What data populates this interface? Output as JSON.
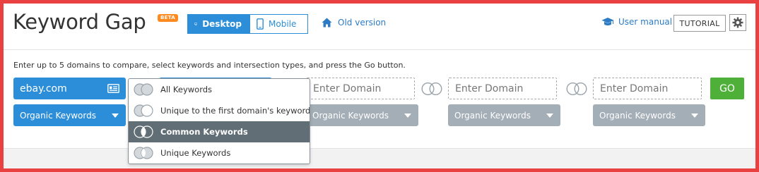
{
  "header": {
    "title": "Keyword Gap",
    "beta_badge": "BETA",
    "device_toggle": {
      "desktop": "Desktop",
      "mobile": "Mobile",
      "active": "desktop"
    },
    "old_version": "Old version",
    "user_manual": "User manual",
    "tutorial": "TUTORIAL"
  },
  "instruction": "Enter up to 5 domains to compare, select keywords and intersection types, and press the Go button.",
  "domains": [
    {
      "value": "ebay.com",
      "placeholder": "Enter Domain",
      "keyword_type": "Organic Keywords"
    },
    {
      "value": "",
      "placeholder": "Enter Domain",
      "keyword_type": "Organic Keywords"
    },
    {
      "value": "",
      "placeholder": "Enter Domain",
      "keyword_type": "Organic Keywords"
    },
    {
      "value": "",
      "placeholder": "Enter Domain",
      "keyword_type": "Organic Keywords"
    }
  ],
  "go_button": "GO",
  "intersection_menu": {
    "items": [
      {
        "label": "All Keywords",
        "selected": false
      },
      {
        "label": "Unique to the first domain's keywords",
        "selected": false
      },
      {
        "label": "Common Keywords",
        "selected": true
      },
      {
        "label": "Unique Keywords",
        "selected": false
      }
    ]
  },
  "colors": {
    "accent_blue": "#2c8ed8",
    "go_green": "#4fb039",
    "beta_orange": "#ff8a1f",
    "frame_red": "#e94141",
    "selected_grey": "#616e76",
    "inactive_select": "#a4aeb6"
  },
  "icons": {
    "desktop": "monitor-icon",
    "mobile": "phone-icon",
    "old_version": "home-icon",
    "user_manual": "graduation-cap-icon",
    "settings": "gear-icon",
    "domain_card": "id-card-icon",
    "intersection": "venn-circles-icon"
  }
}
